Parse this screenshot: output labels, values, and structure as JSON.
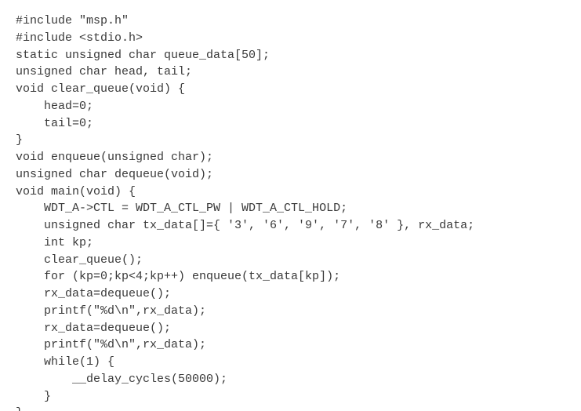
{
  "code": {
    "lines": [
      "#include \"msp.h\"",
      "#include <stdio.h>",
      "static unsigned char queue_data[50];",
      "unsigned char head, tail;",
      "void clear_queue(void) {",
      "    head=0;",
      "    tail=0;",
      "}",
      "void enqueue(unsigned char);",
      "unsigned char dequeue(void);",
      "void main(void) {",
      "    WDT_A->CTL = WDT_A_CTL_PW | WDT_A_CTL_HOLD;",
      "    unsigned char tx_data[]={ '3', '6', '9', '7', '8' }, rx_data;",
      "    int kp;",
      "    clear_queue();",
      "    for (kp=0;kp<4;kp++) enqueue(tx_data[kp]);",
      "    rx_data=dequeue();",
      "    printf(\"%d\\n\",rx_data);",
      "    rx_data=dequeue();",
      "    printf(\"%d\\n\",rx_data);",
      "    while(1) {",
      "        __delay_cycles(50000);",
      "    }",
      "}"
    ]
  }
}
